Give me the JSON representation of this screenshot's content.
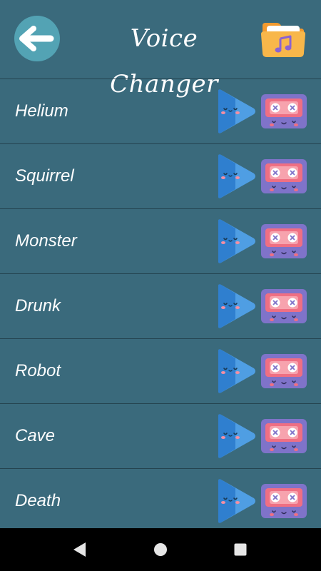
{
  "header": {
    "title": "Voice Changer",
    "back_icon": "arrow-left-icon",
    "folder_icon": "music-folder-icon"
  },
  "voices": [
    {
      "label": "Helium"
    },
    {
      "label": "Squirrel"
    },
    {
      "label": "Monster"
    },
    {
      "label": "Drunk"
    },
    {
      "label": "Robot"
    },
    {
      "label": "Cave"
    },
    {
      "label": "Death"
    }
  ],
  "row_icons": {
    "play": "play-icon",
    "save": "cassette-icon"
  },
  "colors": {
    "background": "#3a6a7c",
    "accent_back_button": "#53a3b4",
    "divider": "#24434f",
    "play_blue": "#2c86d6",
    "cassette_purple": "#7f73c9",
    "cassette_pink": "#ef6f83",
    "folder_orange": "#f6a93b"
  },
  "nav": {
    "back_icon": "nav-back-icon",
    "home_icon": "nav-home-icon",
    "recents_icon": "nav-recents-icon"
  }
}
